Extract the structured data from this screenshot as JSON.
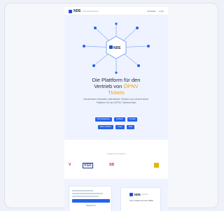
{
  "header": {
    "logo_text": "NDE",
    "logo_sub": "Vertriebsplattform",
    "nav": [
      "Produkte",
      "Login"
    ]
  },
  "hero": {
    "badge": "NDE",
    "title_line1": "Die Plattform für den",
    "title_line2_prefix": "Vertrieb von ",
    "title_highlight": "ÖPNV",
    "title_line3": "Tickets",
    "subtitle": "Gemeinsam verkaufen statt alleine: Einfach und schnell direkt. Plattform für den ÖPNV-Ticketvertrieb"
  },
  "buttons_row1": [
    "Vertriebspartner",
    "Anbieter",
    "Kontakt"
  ],
  "buttons_row2": [
    "Mehr erfahren",
    "Login",
    "Start"
  ],
  "partners": {
    "title": "Vertraut von Partnern",
    "logos": [
      {
        "text": "V",
        "color": "#dc2626"
      },
      {
        "text": "VGF",
        "color": "#1e3a8a"
      },
      {
        "text": "SB",
        "color": "#dc2626"
      },
      {
        "text": "",
        "color": "#eab308"
      }
    ]
  },
  "bottom": {
    "form_footer": "Registrieren",
    "card_logo": "NDE",
    "card_logo_sub": "Vertrieb",
    "card_text": "Ihre Vorteile auf einen Blick"
  },
  "colors": {
    "accent": "#2563eb",
    "highlight": "#f59e0b",
    "hero_bg": "#eef3ff"
  }
}
